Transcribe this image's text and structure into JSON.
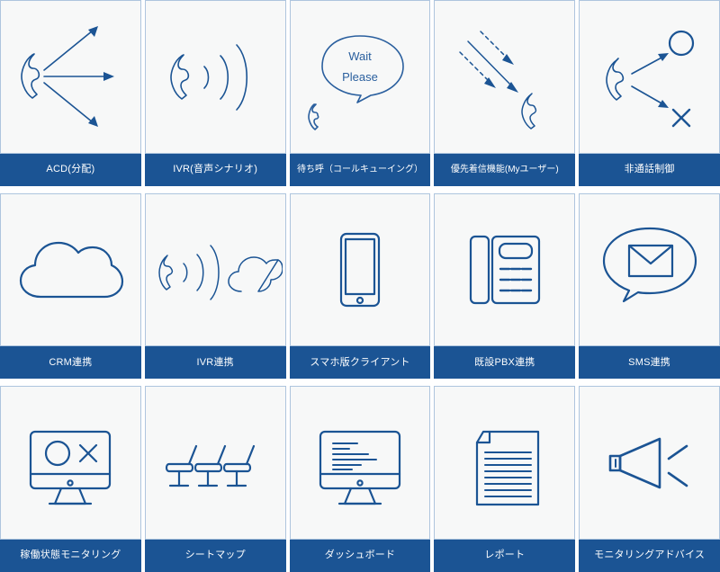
{
  "page": {
    "background": "#ffffff",
    "accent_blue": "#1b5494",
    "card_background": "#f7f8f8",
    "card_border": "#aec5de",
    "label_text_color": "#ffffff",
    "columns": 5,
    "rows": 3
  },
  "cards": [
    {
      "id": "acd",
      "label": "ACD(分配)",
      "icon": "phone-distribute-arrows-icon",
      "tight": false
    },
    {
      "id": "ivr-voice-scenario",
      "label": "IVR(音声シナリオ)",
      "icon": "phone-soundwaves-icon",
      "tight": false
    },
    {
      "id": "call-queuing",
      "label": "待ち呼（コールキューイング）",
      "icon": "wait-please-speech-bubble-icon",
      "tight": true
    },
    {
      "id": "priority-incoming",
      "label": "優先着信機能(Myユーザー)",
      "icon": "incoming-arrows-phone-icon",
      "tight": true
    },
    {
      "id": "non-call-control",
      "label": "非通話制御",
      "icon": "phone-circle-cross-icon",
      "tight": false
    },
    {
      "id": "crm-integration",
      "label": "CRM連携",
      "icon": "cloud-icon",
      "tight": false
    },
    {
      "id": "ivr-integration",
      "label": "IVR連携",
      "icon": "phone-soundwaves-cloud-icon",
      "tight": false
    },
    {
      "id": "smartphone-client",
      "label": "スマホ版クライアント",
      "icon": "smartphone-icon",
      "tight": false
    },
    {
      "id": "existing-pbx",
      "label": "既設PBX連携",
      "icon": "desk-phone-icon",
      "tight": false
    },
    {
      "id": "sms-integration",
      "label": "SMS連携",
      "icon": "speech-bubble-envelope-icon",
      "tight": false
    },
    {
      "id": "status-monitoring",
      "label": "稼働状態モニタリング",
      "icon": "monitor-circle-cross-icon",
      "tight": false
    },
    {
      "id": "seat-map",
      "label": "シートマップ",
      "icon": "three-chairs-icon",
      "tight": false
    },
    {
      "id": "dashboard",
      "label": "ダッシュボード",
      "icon": "monitor-textlines-icon",
      "tight": false
    },
    {
      "id": "report",
      "label": "レポート",
      "icon": "document-page-icon",
      "tight": false
    },
    {
      "id": "monitoring-advice",
      "label": "モニタリングアドバイス",
      "icon": "megaphone-icon",
      "tight": false
    }
  ],
  "bubble": {
    "line1": "Wait",
    "line2": "Please"
  }
}
